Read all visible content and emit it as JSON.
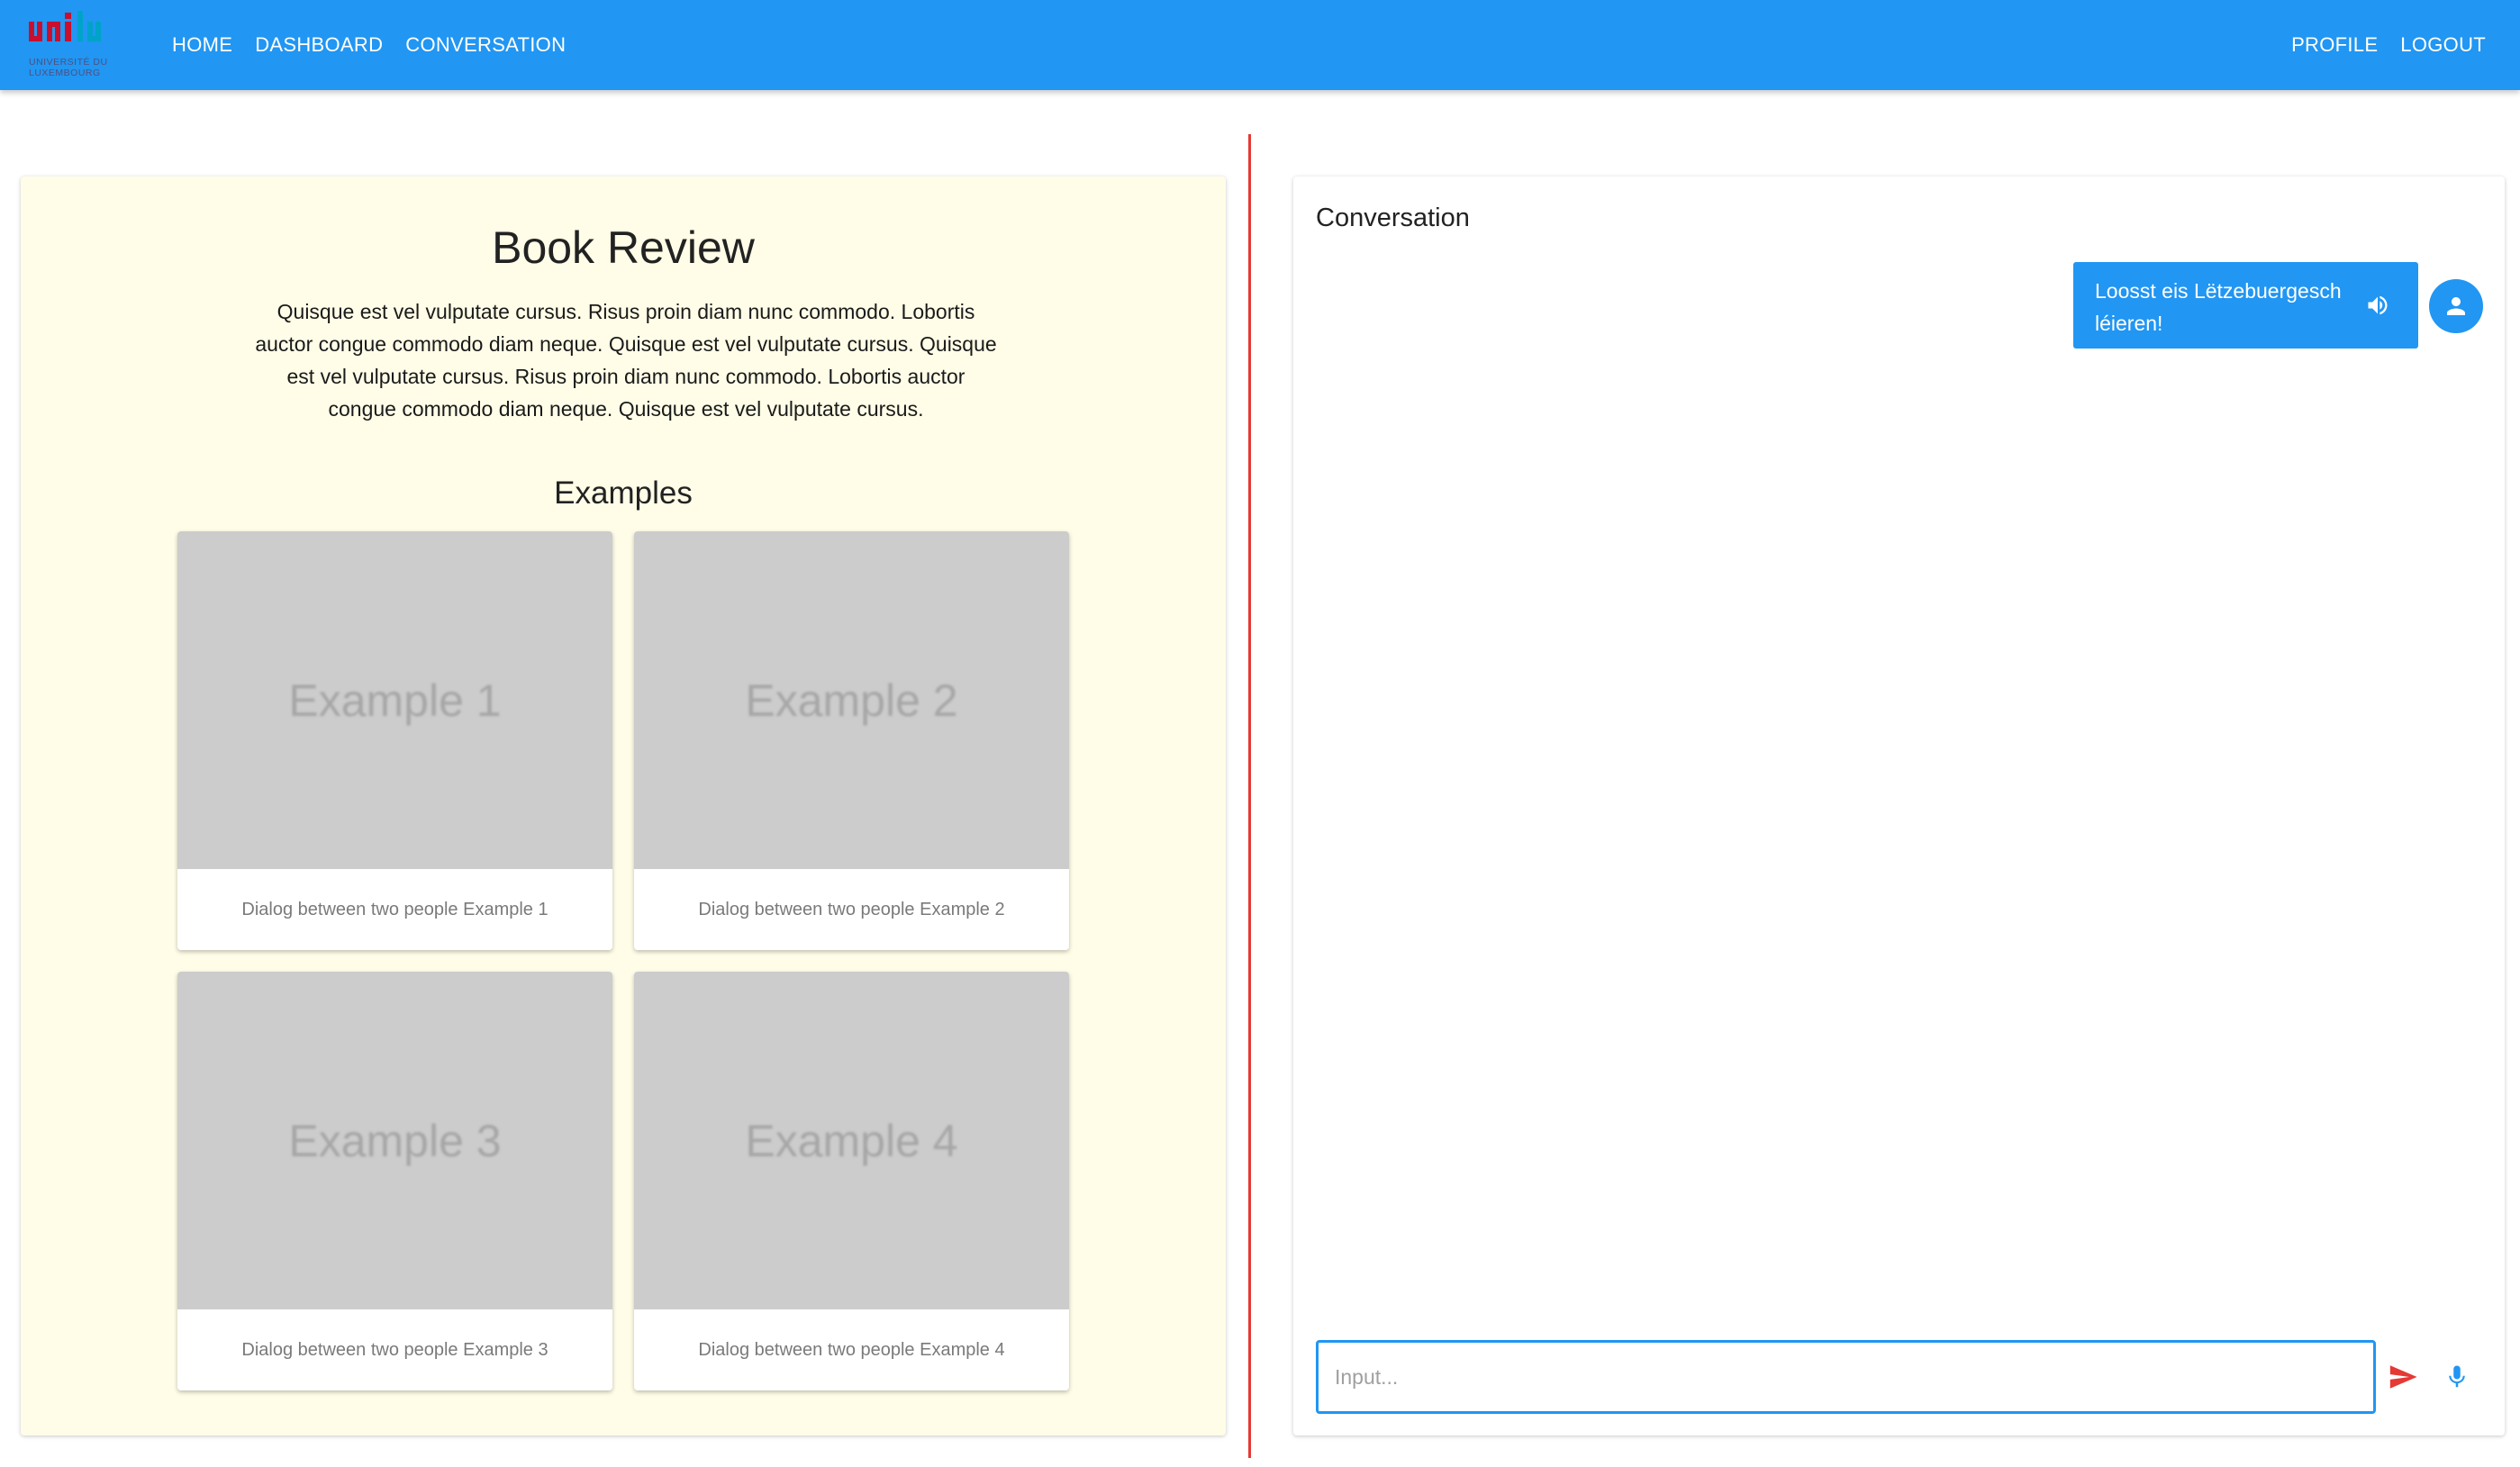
{
  "logo": {
    "mark": "uni.lu",
    "caption": "UNIVERSITÉ DU\nLUXEMBOURG"
  },
  "nav": {
    "left": [
      "HOME",
      "DASHBOARD",
      "CONVERSATION"
    ],
    "right": [
      "PROFILE",
      "LOGOUT"
    ]
  },
  "review": {
    "title": "Book Review",
    "description": "Quisque est vel vulputate cursus. Risus proin diam nunc commodo. Lobortis auctor congue commodo diam neque. Quisque est vel vulputate cursus. Quisque est vel vulputate cursus. Risus proin diam nunc commodo. Lobortis auctor congue commodo diam neque. Quisque est vel vulputate cursus.",
    "examples_title": "Examples",
    "examples": [
      {
        "image_label": "Example 1",
        "caption": "Dialog between two people Example 1"
      },
      {
        "image_label": "Example 2",
        "caption": "Dialog between two people Example 2"
      },
      {
        "image_label": "Example 3",
        "caption": "Dialog between two people Example 3"
      },
      {
        "image_label": "Example 4",
        "caption": "Dialog between two people Example 4"
      }
    ]
  },
  "conversation": {
    "title": "Conversation",
    "messages": [
      {
        "text": "Loosst eis Lëtzebuergesch léieren!",
        "icon": "volume-icon",
        "avatar": "person-icon"
      }
    ],
    "input": {
      "placeholder": "Input...",
      "value": ""
    },
    "send_icon": "send-icon",
    "mic_icon": "microphone-icon"
  },
  "colors": {
    "primary": "#2196f3",
    "divider": "#e53935",
    "send": "#e53935",
    "panel_bg": "#fffde7",
    "card_image": "#cccccc"
  }
}
